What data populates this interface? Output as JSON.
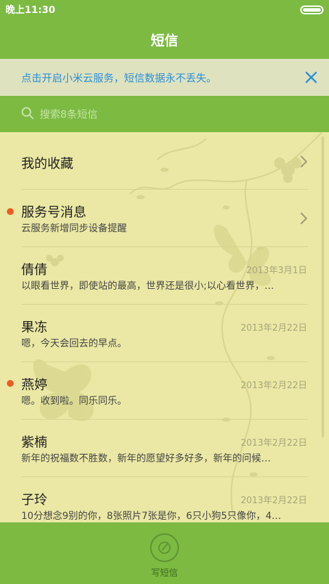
{
  "status": {
    "time": "晚上11:30",
    "battery_icon": "battery-icon"
  },
  "header": {
    "title": "短信"
  },
  "banner": {
    "text": "点击开启小米云服务，短信数据永不丢失。",
    "close_icon": "close-icon"
  },
  "search": {
    "placeholder": "搜索8条短信",
    "icon": "search-icon"
  },
  "conversations": [
    {
      "name": "我的收藏",
      "preview": "",
      "date": "",
      "unread": false,
      "chevron": true
    },
    {
      "name": "服务号消息",
      "preview": "云服务新增同步设备提醒",
      "date": "",
      "unread": true,
      "chevron": true
    },
    {
      "name": "倩倩",
      "preview": "以眼看世界，即使站的最高，世界还是很小;以心看世界，…",
      "date": "2013年3月1日",
      "unread": false,
      "chevron": false
    },
    {
      "name": "果冻",
      "preview": "嗯，今天会回去的早点。",
      "date": "2013年2月22日",
      "unread": false,
      "chevron": false
    },
    {
      "name": "燕婷",
      "preview": "嗯。收到啦。同乐同乐。",
      "date": "2013年2月22日",
      "unread": true,
      "chevron": false
    },
    {
      "name": "紫楠",
      "preview": "新年的祝福数不胜数，新年的愿望好多好多，新年的问候…",
      "date": "2013年2月22日",
      "unread": false,
      "chevron": false
    },
    {
      "name": "子玲",
      "preview": "10分想念9别的你，8张照片7张是你，6只小狗5只像你，4…",
      "date": "2013年2月22日",
      "unread": false,
      "chevron": false
    }
  ],
  "bottom": {
    "compose_label": "写短信",
    "compose_icon": "compose-icon"
  },
  "colors": {
    "accent": "#7cba42",
    "list_bg": "#ebe8a5",
    "unread_dot": "#f15a24",
    "banner_text": "#2a8fd9"
  }
}
